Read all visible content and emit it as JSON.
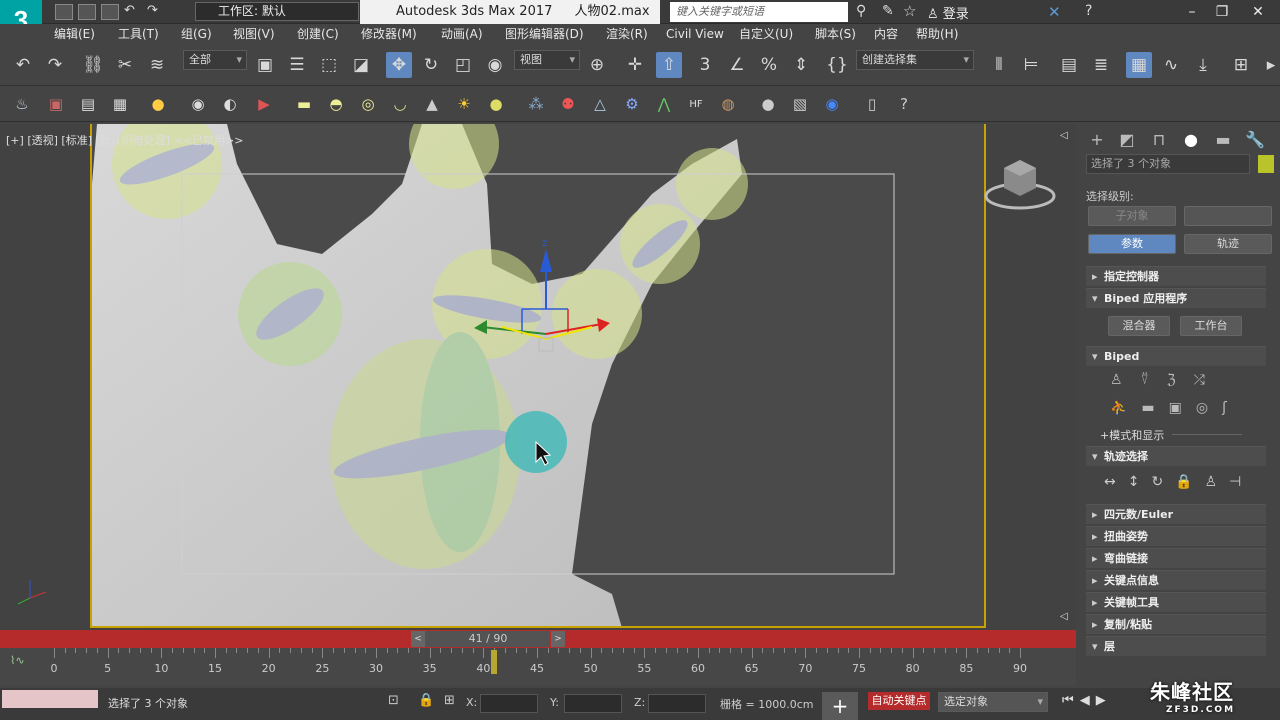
{
  "titlebar": {
    "workspace": "工作区: 默认",
    "app_title": "Autodesk 3ds Max 2017",
    "file": "人物02.max",
    "search_placeholder": "键入关键字或短语",
    "login": "登录",
    "logo": "3"
  },
  "menu": [
    "编辑(E)",
    "工具(T)",
    "组(G)",
    "视图(V)",
    "创建(C)",
    "修改器(M)",
    "动画(A)",
    "图形编辑器(D)",
    "渲染(R)",
    "Civil View",
    "自定义(U)",
    "脚本(S)",
    "内容",
    "帮助(H)"
  ],
  "toolbar": {
    "filter": "全部",
    "ref_coord": "视图",
    "selection_set": "创建选择集"
  },
  "viewport": {
    "label_plus": "[+]",
    "label_view": "[透视]",
    "label_shading": "[标准]",
    "label_lighting": "[默认明暗处理]",
    "label_disabled": "<<已禁用>>",
    "gizmo_z": "z"
  },
  "command_panel": {
    "selection_text": "选择了 3 个对象",
    "selection_level": "选择级别:",
    "sub_object": "子对象",
    "params_button": "参数",
    "track_button": "轨迹",
    "mode_display": "+模式和显示",
    "mixer": "混合器",
    "workbench": "工作台",
    "rollouts": [
      "指定控制器",
      "Biped 应用程序",
      "Biped",
      "轨迹选择",
      "四元数/Euler",
      "扭曲姿势",
      "弯曲链接",
      "关键点信息",
      "关键帧工具",
      "复制/粘贴",
      "层"
    ]
  },
  "timeline": {
    "frame": "41 / 90",
    "current": 41,
    "max": 90,
    "ticks": [
      0,
      5,
      10,
      15,
      20,
      25,
      30,
      35,
      40,
      45,
      50,
      55,
      60,
      65,
      70,
      75,
      80,
      85,
      90
    ]
  },
  "status": {
    "message": "选择了 3 个对象",
    "x_label": "X:",
    "y_label": "Y:",
    "z_label": "Z:",
    "grid": "栅格 = 1000.0cm",
    "auto_key": "自动关键点",
    "selected": "选定对象",
    "watermark": "朱峰社区",
    "watermark_url": "ZF3D.COM"
  },
  "colors": {
    "accent": "#5f87c0",
    "auto_key": "#b52a2a",
    "viewport_border": "#c8a200",
    "logo": "#00a3a3"
  }
}
